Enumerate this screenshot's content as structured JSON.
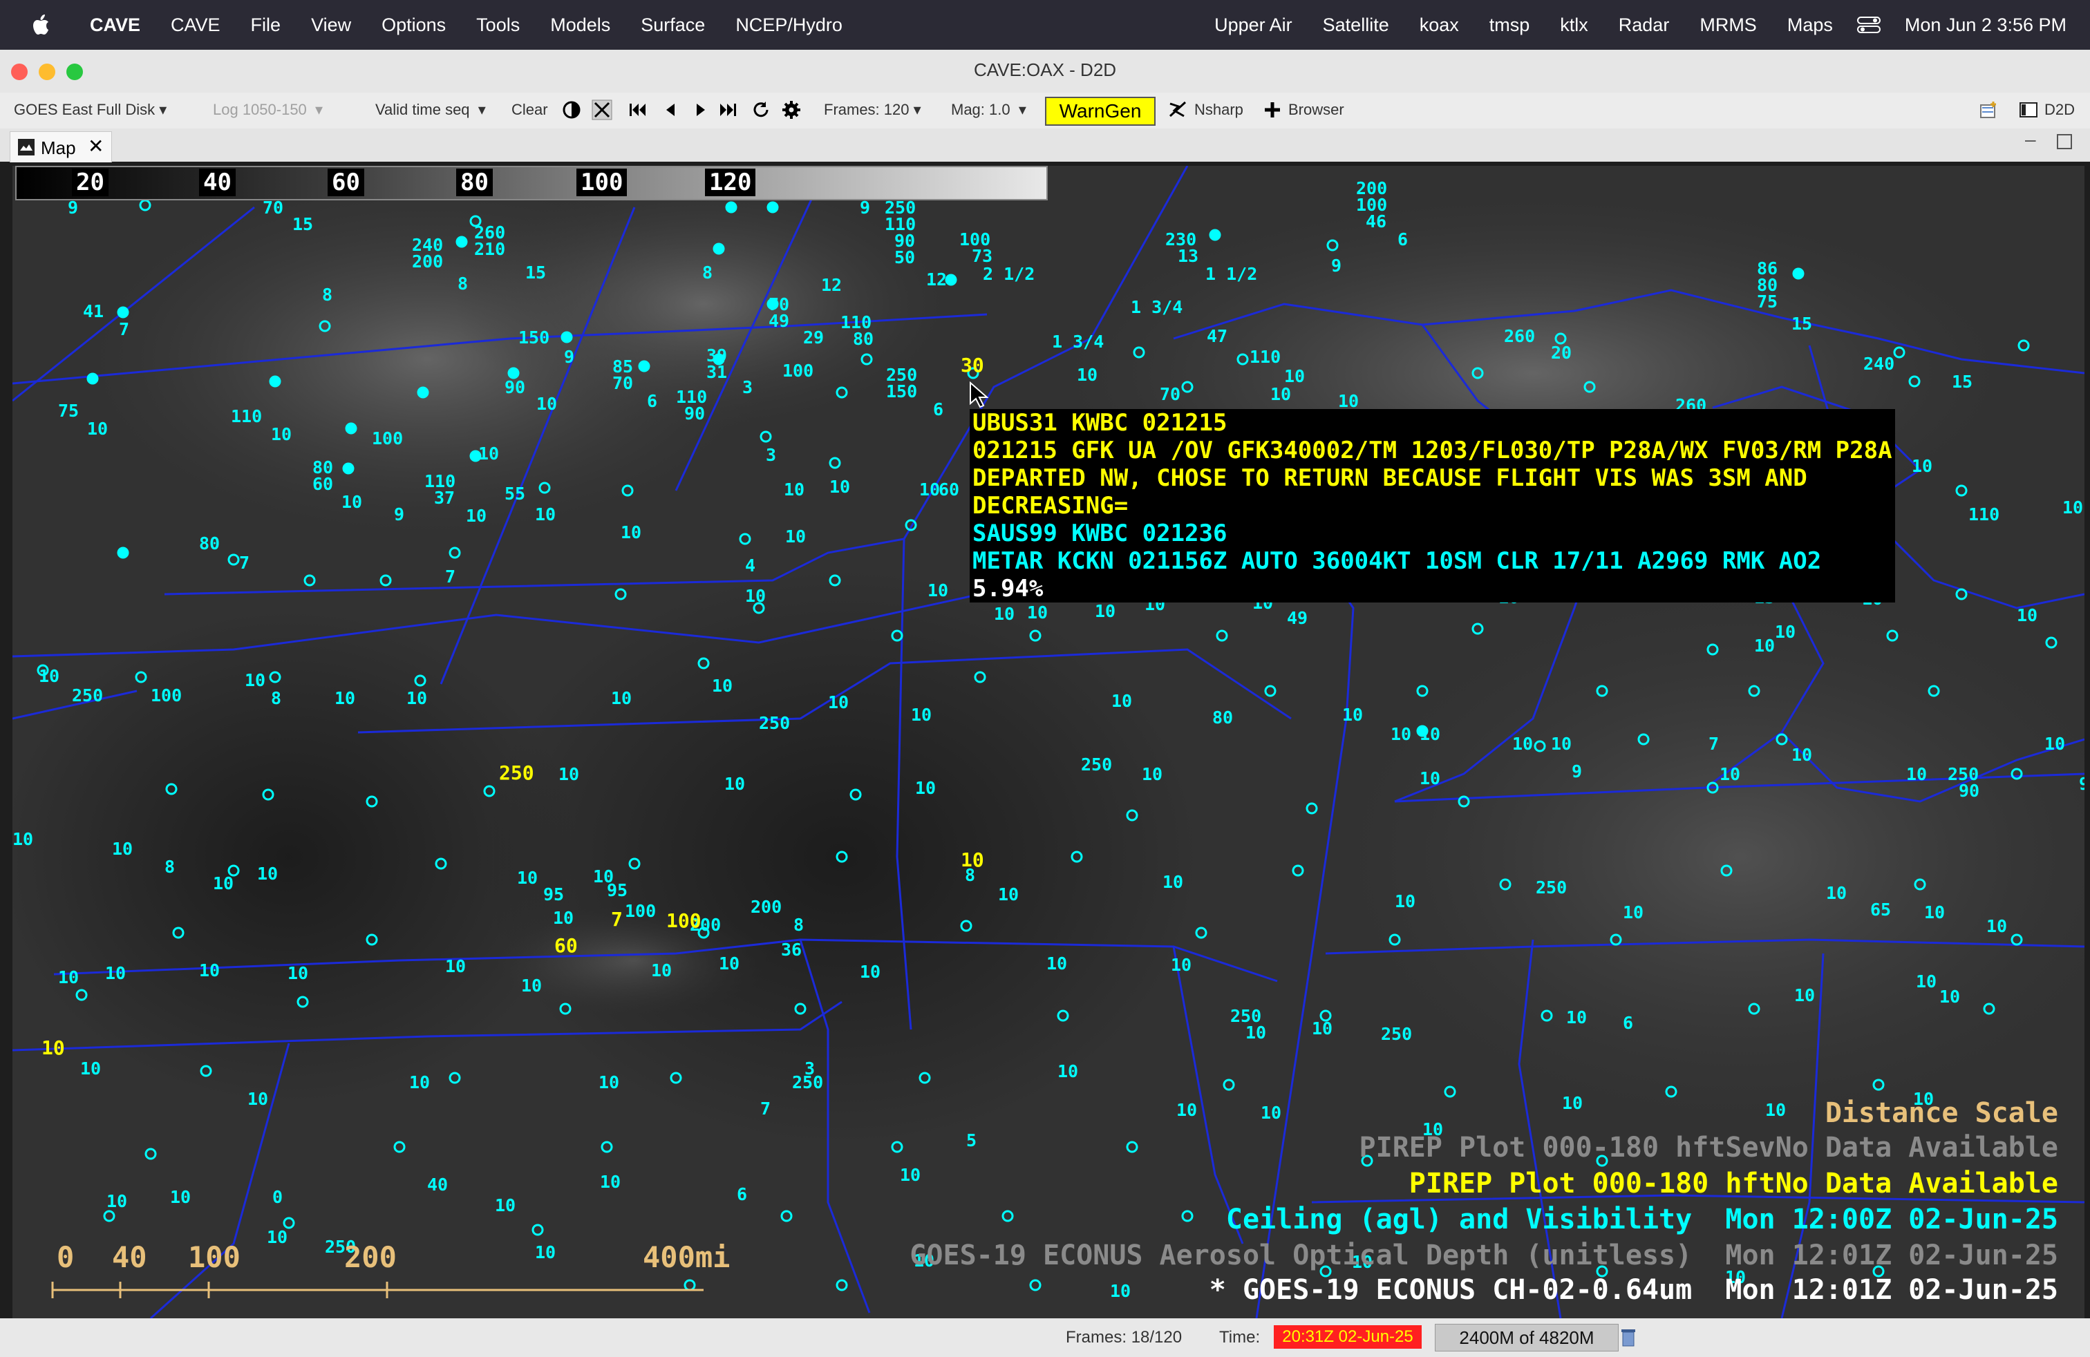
{
  "menubar": {
    "app_name": "CAVE",
    "left_items": [
      "CAVE",
      "File",
      "View",
      "Options",
      "Tools",
      "Models",
      "Surface",
      "NCEP/Hydro"
    ],
    "right_items": [
      "Upper Air",
      "Satellite",
      "koax",
      "tmsp",
      "ktlx",
      "Radar",
      "MRMS",
      "Maps"
    ],
    "clock": "Mon Jun 2  3:56 PM"
  },
  "window": {
    "title": "CAVE:OAX - D2D"
  },
  "toolbar": {
    "dataset": "GOES East Full Disk",
    "log_range": "Log 1050-150",
    "valid_time": "Valid time seq",
    "clear": "Clear",
    "frames": "Frames: 120",
    "mag": "Mag: 1.0",
    "warngen": "WarnGen",
    "nsharp": "Nsharp",
    "browser": "Browser",
    "perspective": "D2D"
  },
  "tab": {
    "label": "Map"
  },
  "colorbar": {
    "labels": [
      "20",
      "40",
      "60",
      "80",
      "100",
      "120"
    ]
  },
  "popup": {
    "lines_yellow": [
      "UBUS31 KWBC 021215",
      "021215 GFK UA /OV GFK340002/TM 1203/FL030/TP P28A/WX FV03/RM P28A",
      "DEPARTED NW, CHOSE TO RETURN BECAUSE FLIGHT VIS WAS 3SM AND",
      "DECREASING="
    ],
    "lines_cyan": [
      "SAUS99 KWBC 021236",
      "METAR KCKN 021156Z AUTO 36004KT 10SM CLR 17/11 A2969 RMK AO2"
    ],
    "value": "5.94%"
  },
  "legend": {
    "distance_scale": "Distance Scale",
    "pirep1_label": "PIREP Plot 000-180 hft",
    "pirep1_status": "SevNo Data Available",
    "pirep2_label": "PIREP Plot 000-180 hft",
    "pirep2_status": "No Data Available",
    "ceiling_label": "Ceiling (agl) and Visibility",
    "ceiling_time": "Mon 12:00Z 02-Jun-25",
    "aod_label": "GOES-19 ECONUS Aerosol Optical Depth (unitless)",
    "aod_time": "Mon 12:01Z 02-Jun-25",
    "ch02_label": "* GOES-19 ECONUS CH-02-0.64um",
    "ch02_time": "Mon 12:01Z 02-Jun-25"
  },
  "scale": {
    "labels": [
      "0",
      "40",
      "100",
      "200",
      "400mi"
    ]
  },
  "stations": [
    "9",
    "70",
    "15",
    "8",
    "9",
    "250",
    "110",
    "90",
    "50",
    "100",
    "73",
    "12",
    "2 1/2",
    "230",
    "13",
    "1 1/2",
    "200",
    "100",
    "46",
    "6",
    "9",
    "41",
    "7",
    "260",
    "210",
    "15",
    "240",
    "200",
    "8",
    "8",
    "70",
    "49",
    "29",
    "100",
    "110",
    "80",
    "12",
    "1 3/4",
    "47",
    "110",
    "10",
    "86",
    "80",
    "75",
    "15",
    "150",
    "9",
    "85",
    "70",
    "6",
    "110",
    "90",
    "39",
    "31",
    "3",
    "250",
    "150",
    "6",
    "30",
    "1 3/4",
    "10",
    "70",
    "10",
    "10",
    "260",
    "20",
    "240",
    "15",
    "75",
    "10",
    "110",
    "10",
    "100",
    "10",
    "90",
    "10",
    "3",
    "10",
    "260",
    "220",
    "80",
    "60",
    "10",
    "110",
    "37",
    "10",
    "55",
    "10",
    "9",
    "10",
    "10",
    "10",
    "10",
    "60",
    "10",
    "95",
    "10",
    "100",
    "10",
    "110",
    "10",
    "80",
    "7",
    "7",
    "4",
    "10",
    "10",
    "10",
    "10",
    "10",
    "10",
    "10",
    "49",
    "10",
    "10",
    "10",
    "13",
    "10",
    "10",
    "10",
    "10",
    "10",
    "250",
    "100",
    "10",
    "8",
    "10",
    "10",
    "10",
    "10",
    "10",
    "250",
    "10",
    "10",
    "80",
    "10",
    "10",
    "10",
    "10",
    "10",
    "7",
    "10",
    "10",
    "250",
    "10",
    "10",
    "10",
    "250",
    "10",
    "10",
    "9",
    "10",
    "10",
    "250",
    "90",
    "9",
    "10",
    "10",
    "8",
    "10",
    "10",
    "10",
    "95",
    "10",
    "95",
    "10",
    "100",
    "60",
    "200",
    "7",
    "100",
    "200",
    "8",
    "10",
    "8",
    "10",
    "10",
    "10",
    "250",
    "10",
    "10",
    "65",
    "10",
    "10",
    "10",
    "10",
    "10",
    "10",
    "10",
    "10",
    "10",
    "10",
    "10",
    "36",
    "10",
    "10",
    "10",
    "250",
    "10",
    "10",
    "250",
    "10",
    "6",
    "10",
    "10",
    "10",
    "10",
    "10",
    "10",
    "10",
    "7",
    "3",
    "250",
    "10",
    "10",
    "5",
    "10",
    "10",
    "10",
    "10",
    "10",
    "10",
    "10",
    "10",
    "0",
    "40",
    "10",
    "10",
    "10",
    "250",
    "10",
    "6",
    "10",
    "10",
    "10",
    "10",
    "10",
    "10",
    "10",
    "10"
  ]
}
